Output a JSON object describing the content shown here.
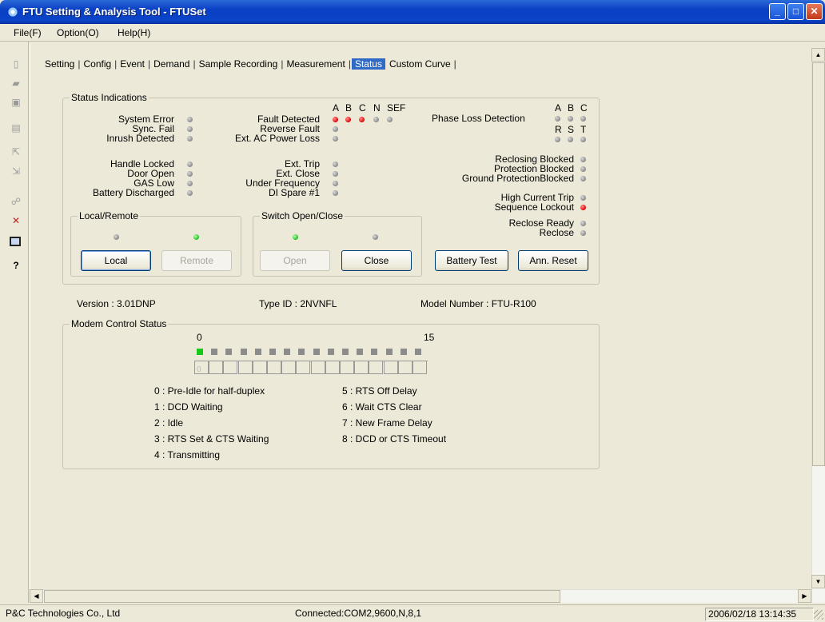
{
  "window": {
    "title": "FTU Setting & Analysis Tool - FTUSet"
  },
  "menu": {
    "file": "File(F)",
    "option": "Option(O)",
    "help": "Help(H)"
  },
  "tabs": [
    "Setting",
    "Config",
    "Event",
    "Demand",
    "Sample Recording",
    "Measurement",
    "Status",
    "Custom Curve"
  ],
  "active_tab": "Status",
  "status_indications": {
    "title": "Status Indications",
    "phase_header": {
      "a": "A",
      "b": "B",
      "c": "C",
      "n": "N",
      "sef": "SEF"
    },
    "left_group1": [
      "System Error",
      "Sync. Fail",
      "Inrush Detected"
    ],
    "left_group2": [
      "Handle Locked",
      "Door Open",
      "GAS Low",
      "Battery Discharged"
    ],
    "mid_group1": [
      "Fault Detected",
      "Reverse Fault",
      "Ext. AC Power Loss"
    ],
    "mid_group2": [
      "Ext. Trip",
      "Ext. Close",
      "Under Frequency",
      "DI Spare #1"
    ],
    "phase_loss": {
      "label": "Phase Loss Detection",
      "top": {
        "a": "A",
        "b": "B",
        "c": "C"
      },
      "bottom": {
        "r": "R",
        "s": "S",
        "t": "T"
      }
    },
    "right_group": [
      "Reclosing Blocked",
      "Protection Blocked",
      "Ground ProtectionBlocked"
    ],
    "right_group2": [
      "High Current Trip",
      "Sequence Lockout",
      "Reclose Ready",
      "Reclose"
    ],
    "fault_detected_leds": [
      "red",
      "red",
      "red",
      "gray",
      "gray"
    ]
  },
  "local_remote": {
    "title": "Local/Remote",
    "local": "Local",
    "remote": "Remote"
  },
  "switch": {
    "title": "Switch Open/Close",
    "open": "Open",
    "close": "Close"
  },
  "buttons": {
    "battery_test": "Battery Test",
    "ann_reset": "Ann. Reset"
  },
  "info": {
    "version": "Version : 3.01DNP",
    "type_id": "Type ID : 2NVNFL",
    "model": "Model Number : FTU-R100"
  },
  "modem": {
    "title": "Modem Control Status",
    "scale_start": "0",
    "scale_end": "15",
    "states_left": [
      "0 : Pre-Idle for half-duplex",
      "1 : DCD Waiting",
      "2 : Idle",
      "3 : RTS Set & CTS Waiting",
      "4 : Transmitting"
    ],
    "states_right": [
      "5 : RTS Off Delay",
      "6 : Wait CTS Clear",
      "7 : New Frame Delay",
      "8 : DCD or CTS Timeout"
    ],
    "active_cell": "0"
  },
  "statusbar": {
    "company": "P&C Technologies Co., Ltd",
    "connection": "Connected:COM2,9600,N,8,1",
    "datetime": "2006/02/18 13:14:35"
  }
}
